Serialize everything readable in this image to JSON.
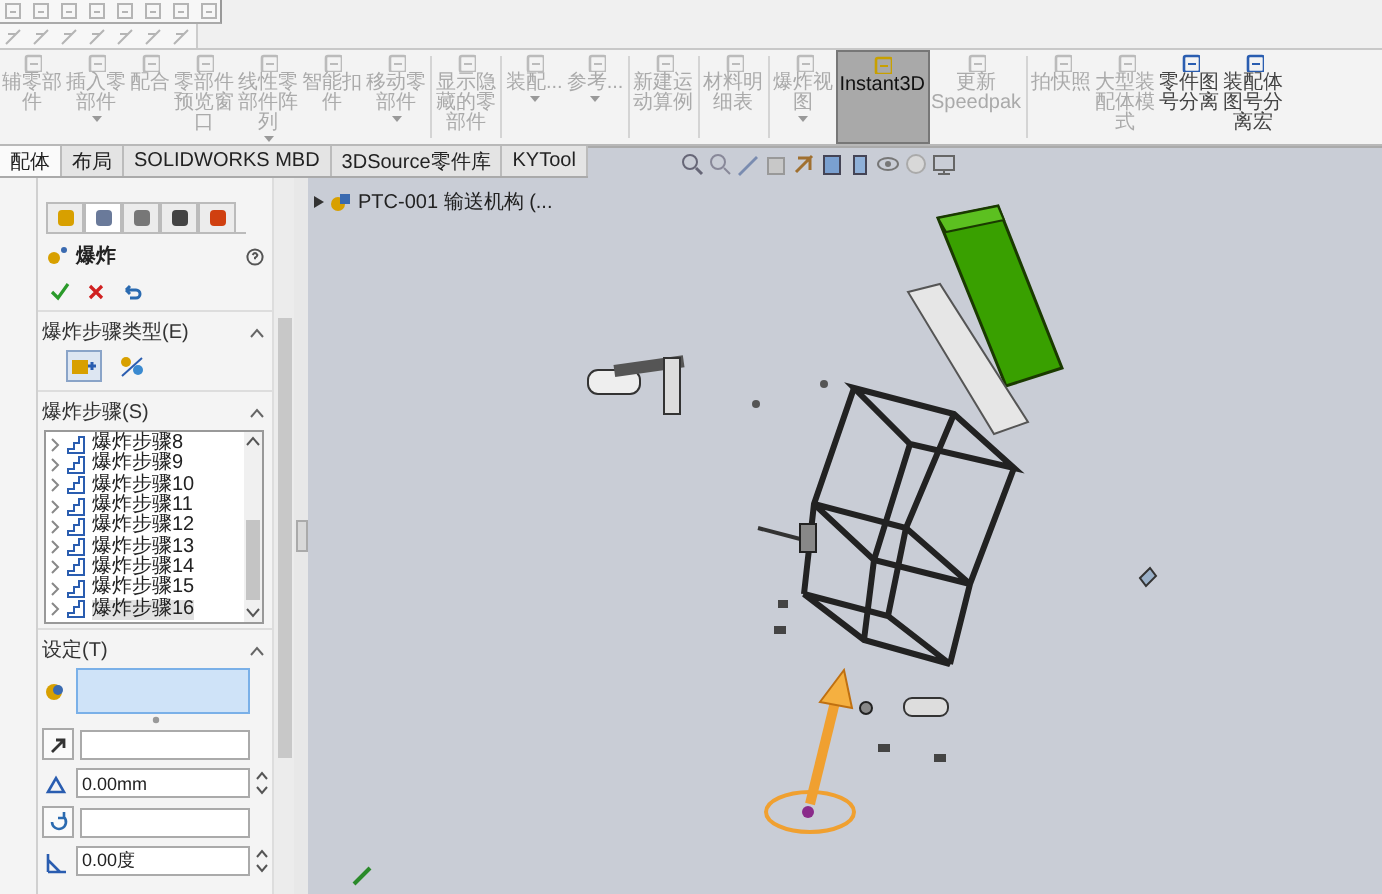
{
  "ribbon": {
    "buttons": [
      {
        "label": "辅零部件",
        "disabled": true,
        "dropdown": false,
        "selected": false
      },
      {
        "label": "插入零部件",
        "disabled": true,
        "dropdown": true,
        "selected": false
      },
      {
        "label": "配合",
        "disabled": true,
        "dropdown": false,
        "selected": false
      },
      {
        "label": "零部件预览窗口",
        "disabled": true,
        "dropdown": false,
        "selected": false
      },
      {
        "label": "线性零部件阵列",
        "disabled": true,
        "dropdown": true,
        "selected": false
      },
      {
        "label": "智能扣件",
        "disabled": true,
        "dropdown": false,
        "selected": false
      },
      {
        "label": "移动零部件",
        "disabled": true,
        "dropdown": true,
        "selected": false
      },
      {
        "label": "显示隐藏的零部件",
        "disabled": true,
        "dropdown": false,
        "selected": false
      },
      {
        "label": "装配...",
        "disabled": true,
        "dropdown": true,
        "selected": false
      },
      {
        "label": "参考...",
        "disabled": true,
        "dropdown": true,
        "selected": false
      },
      {
        "label": "新建运动算例",
        "disabled": true,
        "dropdown": false,
        "selected": false
      },
      {
        "label": "材料明细表",
        "disabled": true,
        "dropdown": false,
        "selected": false
      },
      {
        "label": "爆炸视图",
        "disabled": true,
        "dropdown": true,
        "selected": false
      },
      {
        "label": "Instant3D",
        "disabled": false,
        "dropdown": false,
        "selected": true
      },
      {
        "label": "更新\nSpeedpak",
        "disabled": true,
        "dropdown": false,
        "selected": false
      },
      {
        "label": "拍快照",
        "disabled": true,
        "dropdown": false,
        "selected": false
      },
      {
        "label": "大型装配体模式",
        "disabled": true,
        "dropdown": false,
        "selected": false
      },
      {
        "label": "零件图号分离",
        "disabled": false,
        "dropdown": false,
        "selected": false
      },
      {
        "label": "装配体图号分离宏",
        "disabled": false,
        "dropdown": false,
        "selected": false
      }
    ]
  },
  "tabs": [
    {
      "label": "配体",
      "selected": true
    },
    {
      "label": "布局",
      "selected": false
    },
    {
      "label": "SOLIDWORKS MBD",
      "selected": false
    },
    {
      "label": "3DSource零件库",
      "selected": false
    },
    {
      "label": "KYTool",
      "selected": false
    }
  ],
  "property_manager": {
    "tabs": [
      {
        "selected": false
      },
      {
        "selected": true
      },
      {
        "selected": false
      },
      {
        "selected": false
      },
      {
        "selected": false
      }
    ],
    "title": "爆炸",
    "step_type": {
      "title": "爆炸步骤类型(E)",
      "options": [
        {
          "selected": true
        },
        {
          "selected": false
        }
      ]
    },
    "steps": {
      "title": "爆炸步骤(S)",
      "items": [
        {
          "label": "爆炸步骤8",
          "selected": false
        },
        {
          "label": "爆炸步骤9",
          "selected": false
        },
        {
          "label": "爆炸步骤10",
          "selected": false
        },
        {
          "label": "爆炸步骤11",
          "selected": false
        },
        {
          "label": "爆炸步骤12",
          "selected": false
        },
        {
          "label": "爆炸步骤13",
          "selected": false
        },
        {
          "label": "爆炸步骤14",
          "selected": false
        },
        {
          "label": "爆炸步骤15",
          "selected": false
        },
        {
          "label": "爆炸步骤16",
          "selected": true
        }
      ]
    },
    "settings": {
      "title": "设定(T)",
      "fields": [
        {
          "kind": "selection",
          "selected": true
        },
        {
          "kind": "direction",
          "selected": false
        },
        {
          "kind": "distance",
          "value": "0.00mm",
          "selected": false
        },
        {
          "kind": "rotation",
          "selected": false
        },
        {
          "kind": "angle",
          "value": "0.00度",
          "selected": false
        }
      ]
    }
  },
  "viewport": {
    "tree_item": "PTC-001 输送机构 (..."
  }
}
